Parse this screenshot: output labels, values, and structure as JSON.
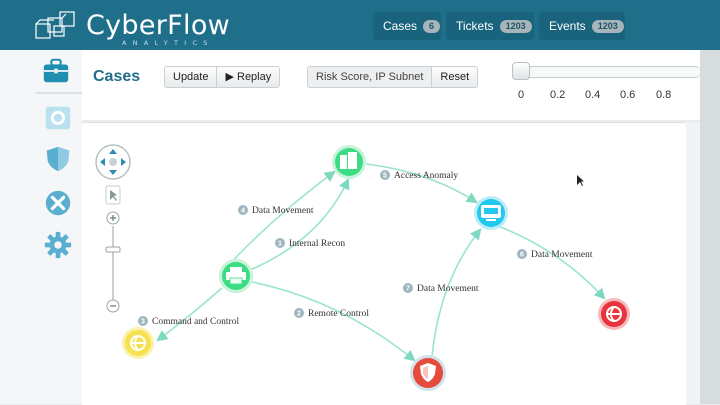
{
  "app": {
    "name": "CyberFlow",
    "subtitle": "ANALYTICS"
  },
  "nav": {
    "tabs": [
      {
        "label": "Cases",
        "badge": "6"
      },
      {
        "label": "Tickets",
        "badge": "1203"
      },
      {
        "label": "Events",
        "badge": "1203"
      }
    ]
  },
  "sidebar": {
    "items": [
      {
        "icon": "briefcase-icon",
        "active": true
      },
      {
        "icon": "calendar-icon",
        "active": false
      },
      {
        "icon": "shield-icon",
        "active": false
      },
      {
        "icon": "close-circle-icon",
        "active": false
      },
      {
        "icon": "gear-icon",
        "active": false
      }
    ]
  },
  "toolbar": {
    "title": "Cases",
    "update_label": "Update",
    "replay_label": "▶ Replay",
    "filter_value": "Risk Score, IP Subnet",
    "reset_label": "Reset"
  },
  "slider": {
    "ticks": [
      "0",
      "0.2",
      "0.4",
      "0.6",
      "0.8"
    ],
    "value": 0
  },
  "colors": {
    "brand": "#1f6f8b",
    "node_green": "#3ddc84",
    "node_cyan": "#22c8ee",
    "node_red": "#e8343c",
    "node_orange_red": "#e64a3c",
    "node_yellow": "#f7e150",
    "edge": "#8fe0c8"
  },
  "graph": {
    "edges": [
      {
        "num": "4",
        "label": "Data Movement"
      },
      {
        "num": "1",
        "label": "Internal Recon"
      },
      {
        "num": "5",
        "label": "Access Anomaly"
      },
      {
        "num": "6",
        "label": "Data Movement"
      },
      {
        "num": "7",
        "label": "Data Movement"
      },
      {
        "num": "2",
        "label": "Remote Control"
      },
      {
        "num": "3",
        "label": "Command and Control"
      }
    ]
  }
}
